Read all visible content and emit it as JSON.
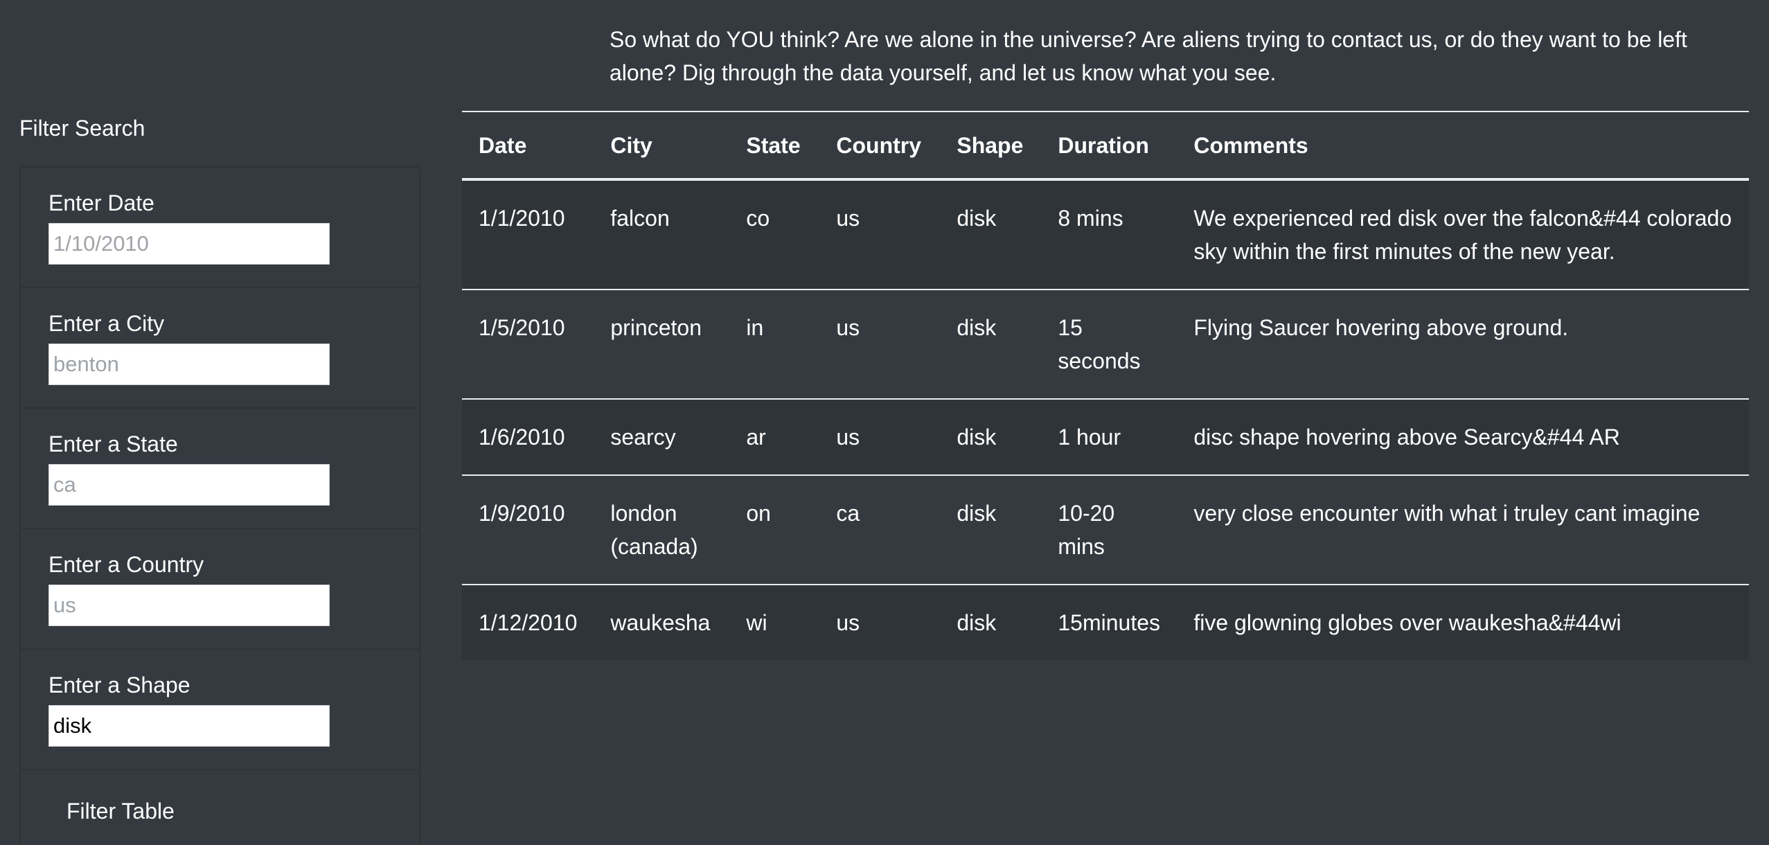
{
  "intro": {
    "text": "So what do YOU think? Are we alone in the universe? Are aliens trying to contact us, or do they want to be left alone? Dig through the data yourself, and let us know what you see."
  },
  "filters": {
    "heading": "Filter Search",
    "date": {
      "label": "Enter Date",
      "placeholder": "1/10/2010",
      "value": ""
    },
    "city": {
      "label": "Enter a City",
      "placeholder": "benton",
      "value": ""
    },
    "state": {
      "label": "Enter a State",
      "placeholder": "ca",
      "value": ""
    },
    "country": {
      "label": "Enter a Country",
      "placeholder": "us",
      "value": ""
    },
    "shape": {
      "label": "Enter a Shape",
      "placeholder": "",
      "value": "disk"
    },
    "button_label": "Filter Table"
  },
  "table": {
    "headers": [
      "Date",
      "City",
      "State",
      "Country",
      "Shape",
      "Duration",
      "Comments"
    ],
    "rows": [
      [
        "1/1/2010",
        "falcon",
        "co",
        "us",
        "disk",
        "8 mins",
        "We experienced red disk over the falcon&#44 colorado sky within the first minutes of the new year."
      ],
      [
        "1/5/2010",
        "princeton",
        "in",
        "us",
        "disk",
        "15 seconds",
        "Flying Saucer hovering above ground."
      ],
      [
        "1/6/2010",
        "searcy",
        "ar",
        "us",
        "disk",
        "1 hour",
        "disc shape hovering above Searcy&#44 AR"
      ],
      [
        "1/9/2010",
        "london (canada)",
        "on",
        "ca",
        "disk",
        "10-20 mins",
        "very close encounter with what i truley cant imagine"
      ],
      [
        "1/12/2010",
        "waukesha",
        "wi",
        "us",
        "disk",
        "15minutes",
        "five glowning globes over waukesha&#44wi"
      ]
    ]
  },
  "colors": {
    "background": "#343a40",
    "row_stripe": "#2f3439",
    "rule": "#e9ecef",
    "text": "#ffffff"
  }
}
